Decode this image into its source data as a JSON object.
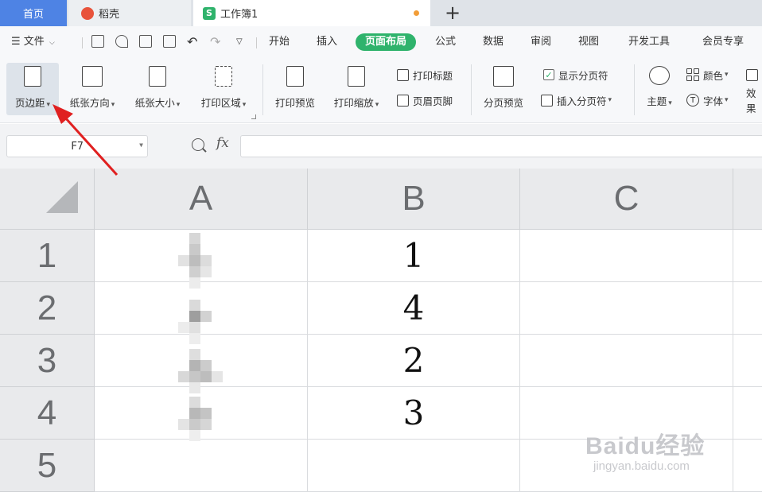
{
  "tabs": {
    "home": "首页",
    "daoke": "稻壳",
    "workbook": "工作簿1",
    "new_tab": "+"
  },
  "menubar": {
    "file_label": "文件",
    "items": [
      "开始",
      "插入",
      "页面布局",
      "公式",
      "数据",
      "审阅",
      "视图",
      "开发工具",
      "会员专享"
    ],
    "active": "页面布局"
  },
  "ribbon": {
    "margins": "页边距",
    "orientation": "纸张方向",
    "size": "纸张大小",
    "print_area": "打印区域",
    "print_preview": "打印预览",
    "print_scale": "打印缩放",
    "print_titles": "打印标题",
    "header_footer": "页眉页脚",
    "page_break_preview": "分页预览",
    "show_page_breaks": "显示分页符",
    "insert_page_break": "插入分页符",
    "theme": "主题",
    "colors": "颜色",
    "fonts": "字体",
    "effects": "效果"
  },
  "formula_bar": {
    "name_box": "F7",
    "fx": "fx",
    "formula": ""
  },
  "sheet": {
    "columns": [
      "A",
      "B",
      "C"
    ],
    "rows": [
      "1",
      "2",
      "3",
      "4",
      "5"
    ],
    "col_b_values": [
      "1",
      "4",
      "2",
      "3",
      ""
    ]
  },
  "watermark": {
    "main": "Baidu经验",
    "sub": "jingyan.baidu.com"
  },
  "colors": {
    "active_tab": "#4e83e4",
    "active_menu": "#2fb36c",
    "arrow": "#e02020"
  }
}
